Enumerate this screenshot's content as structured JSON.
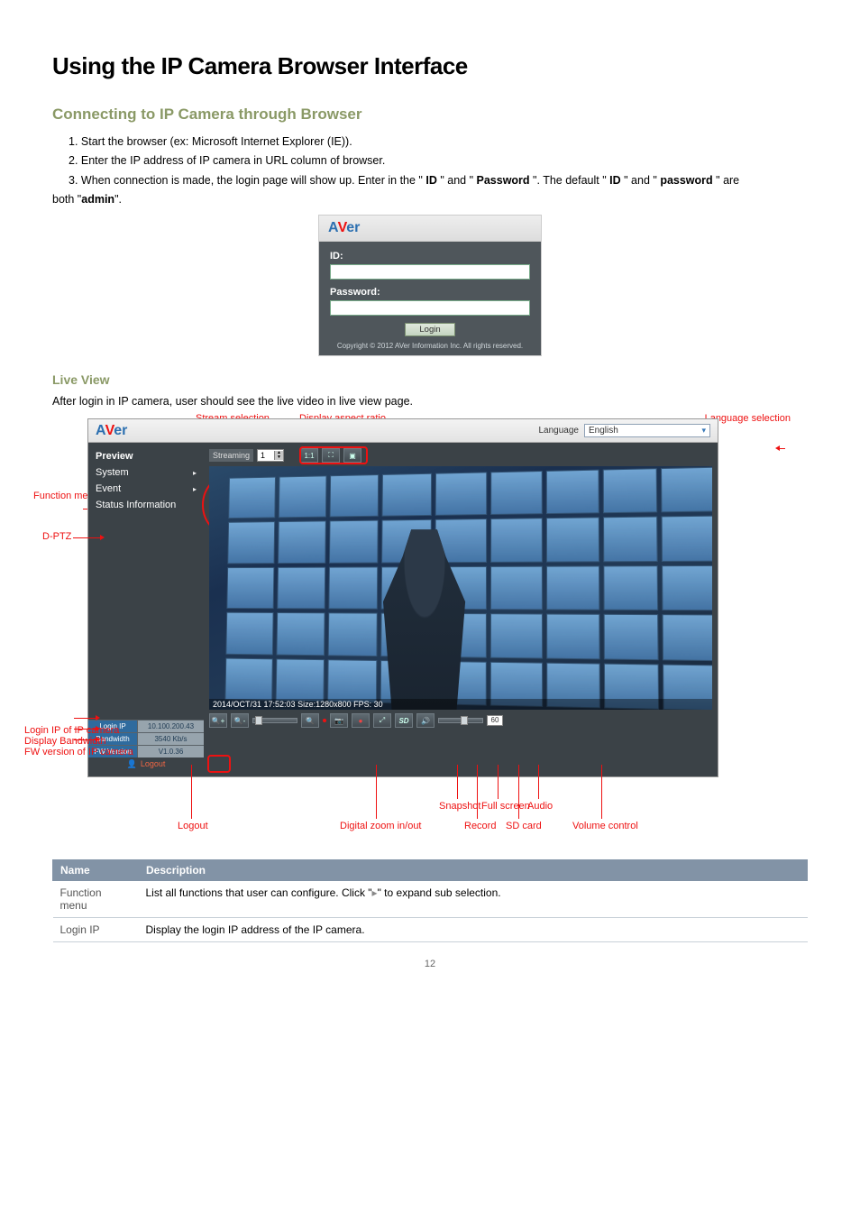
{
  "page_number": "12",
  "h1": "Using the IP Camera Browser Interface",
  "sec1": {
    "title": "Connecting to IP Camera through Browser",
    "l1a": "1. Start the browser (ex: Microsoft Internet Explorer (IE)).",
    "l1b": "2. Enter the IP address of IP camera in URL column of browser.",
    "l1c_pre": "3. When connection is made, the login page will show up. Enter",
    "l1c_id": "ID",
    "l1c_and": "\" and \"",
    "l1c_pw": "Password",
    "l1c_def": "\". The default \"",
    "l1c_ID2": "ID",
    "l1c_and2": "\" and \"",
    "l1c_pw2": "password",
    "l1c_end": "\" are ",
    "l1d": "both \"",
    "l1d_val": "admin",
    "l1d_end": "\"."
  },
  "login": {
    "id_label": "ID:",
    "pw_label": "Password:",
    "btn": "Login",
    "copy": "Copyright © 2012 AVer Information Inc. All rights reserved."
  },
  "sec2": {
    "title": "Live View",
    "intro": "After login in IP camera, user should see the live video in live view page."
  },
  "callouts": {
    "stream_sel": "Stream selection",
    "aspect": "Display aspect ratio",
    "lang": "Language selection",
    "menu": "Function menu",
    "dptz": "D-PTZ",
    "login_ip": "Login IP of IP camera",
    "bw": "Display Bandwidth",
    "fw": "FW version of IP camera",
    "logout": "Logout",
    "dzoom": "Digital zoom in/out",
    "rec": "Record",
    "snap": "Snapshot",
    "full": "Full screen",
    "sd": "SD card",
    "aud": "Audio",
    "vol": "Volume control"
  },
  "app": {
    "brand": "AVer",
    "lang_label": "Language",
    "lang_value": "English",
    "menu": [
      "Preview",
      "System",
      "Event",
      "Status Information"
    ],
    "menu_arrow": "▸",
    "stats": {
      "ip_k": "Login IP",
      "ip_v": "10.100.200.43",
      "bw_k": "Bandwidth",
      "bw_v": "3540 Kb/s",
      "fw_k": "FW Version",
      "fw_v": "V1.0.36"
    },
    "logout": "Logout",
    "streaming": "Streaming",
    "stream_val": "1",
    "osd": "2014/OCT/31 17:52:03 Size:1280x800 FPS: 30",
    "home": "⌂",
    "vol": "60"
  },
  "table": {
    "h1": "Name",
    "h2": "Description",
    "rows": [
      {
        "n": "Function menu",
        "d_pre": "List all functions that user can configure. Click \"",
        "d_arrow": "▸",
        "d_post": "\" to expand sub selection."
      },
      {
        "n": "Login IP",
        "d": "Display the login IP address of the IP camera."
      }
    ]
  }
}
